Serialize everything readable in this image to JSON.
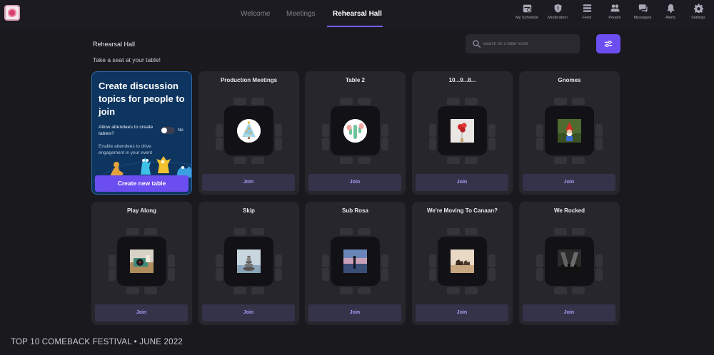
{
  "nav": {
    "logo_icon": "festival-logo-icon",
    "tabs": [
      {
        "label": "Welcome",
        "active": false
      },
      {
        "label": "Meetings",
        "active": false
      },
      {
        "label": "Rehearsal Hall",
        "active": true
      }
    ],
    "icons": [
      {
        "label": "My Schedule",
        "icon": "schedule-icon"
      },
      {
        "label": "Moderation",
        "icon": "shield-icon"
      },
      {
        "label": "Feed",
        "icon": "feed-icon"
      },
      {
        "label": "People",
        "icon": "people-icon"
      },
      {
        "label": "Messages",
        "icon": "messages-icon"
      },
      {
        "label": "Alerts",
        "icon": "bell-icon"
      },
      {
        "label": "Settings",
        "icon": "gear-icon"
      }
    ],
    "accent": "#7a5cf5"
  },
  "header": {
    "title": "Rehearsal Hall",
    "subtitle": "Take a seat at your table!",
    "search_placeholder": "Search for a table name",
    "filter_icon": "sliders-icon"
  },
  "create_card": {
    "title": "Create discussion topics for people to join",
    "allow_label": "Allow attendees to create tables?",
    "toggle_state": "No",
    "enable_text": "Enable attendees to drive engagement in your event",
    "button_label": "Create new table"
  },
  "tables": [
    {
      "name": "Production Meetings",
      "join_label": "Join",
      "image": "christmas-tree-avatar"
    },
    {
      "name": "Table 2",
      "join_label": "Join",
      "image": "cactus-hands-avatar"
    },
    {
      "name": "10...9...8...",
      "join_label": "Join",
      "image": "red-balloons-photo"
    },
    {
      "name": "Gnomes",
      "join_label": "Join",
      "image": "garden-gnome-photo"
    },
    {
      "name": "Play Along",
      "join_label": "Join",
      "image": "record-player-photo"
    },
    {
      "name": "Skip",
      "join_label": "Join",
      "image": "stacked-stones-photo"
    },
    {
      "name": "Sub Rosa",
      "join_label": "Join",
      "image": "sunset-silhouette-photo"
    },
    {
      "name": "We're Moving To Canaan?",
      "join_label": "Join",
      "image": "camel-desert-photo"
    },
    {
      "name": "We Rocked",
      "join_label": "Join",
      "image": "concert-crowd-photo"
    }
  ],
  "colors": {
    "background": "#1a191e",
    "card": "#27262c",
    "primary_button": "#6b4ef0",
    "join_button": "#34334a",
    "join_text": "#a99cf5",
    "create_card_bg": "#0e3560"
  },
  "footer": {
    "text": "TOP 10 COMEBACK FESTIVAL • JUNE 2022"
  }
}
